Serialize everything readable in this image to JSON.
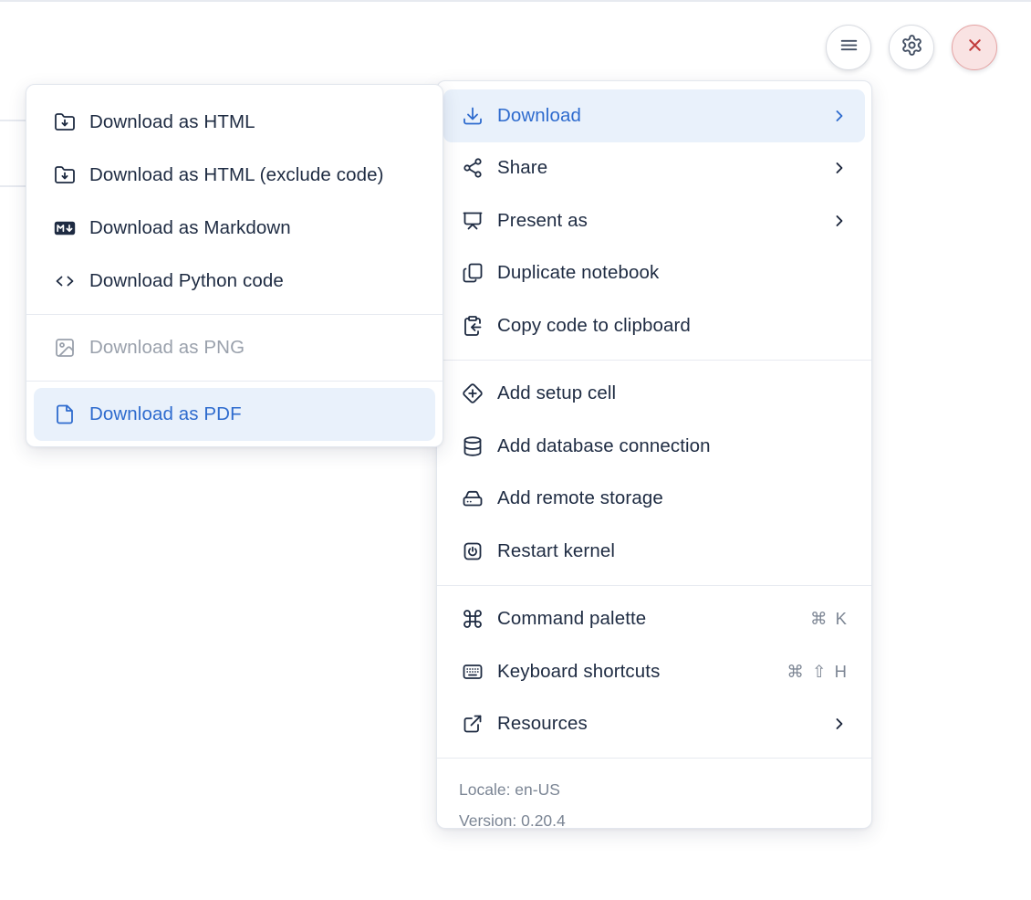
{
  "toolbar": {
    "menu_button": {
      "icon": "hamburger-icon"
    },
    "settings_button": {
      "icon": "gear-icon"
    },
    "close_button": {
      "icon": "close-icon"
    }
  },
  "download_submenu": {
    "items": [
      {
        "label": "Download as HTML",
        "icon": "folder-download-icon",
        "state": "normal"
      },
      {
        "label": "Download as HTML (exclude code)",
        "icon": "folder-download-icon",
        "state": "normal"
      },
      {
        "label": "Download as Markdown",
        "icon": "markdown-icon",
        "state": "normal"
      },
      {
        "label": "Download Python code",
        "icon": "code-icon",
        "state": "normal"
      },
      {
        "label": "Download as PNG",
        "icon": "image-icon",
        "state": "disabled"
      },
      {
        "label": "Download as PDF",
        "icon": "file-icon",
        "state": "highlighted"
      }
    ]
  },
  "main_menu": {
    "sections": [
      {
        "items": [
          {
            "label": "Download",
            "icon": "download-icon",
            "has_submenu": true,
            "state": "highlighted"
          },
          {
            "label": "Share",
            "icon": "share-icon",
            "has_submenu": true
          },
          {
            "label": "Present as",
            "icon": "presentation-icon",
            "has_submenu": true
          },
          {
            "label": "Duplicate notebook",
            "icon": "copy-icon"
          },
          {
            "label": "Copy code to clipboard",
            "icon": "clipboard-copy-icon"
          }
        ]
      },
      {
        "items": [
          {
            "label": "Add setup cell",
            "icon": "diamond-plus-icon"
          },
          {
            "label": "Add database connection",
            "icon": "database-icon"
          },
          {
            "label": "Add remote storage",
            "icon": "hard-drive-icon"
          },
          {
            "label": "Restart kernel",
            "icon": "power-square-icon"
          }
        ]
      },
      {
        "items": [
          {
            "label": "Command palette",
            "icon": "command-icon",
            "shortcut": "⌘ K"
          },
          {
            "label": "Keyboard shortcuts",
            "icon": "keyboard-icon",
            "shortcut": "⌘ ⇧ H"
          },
          {
            "label": "Resources",
            "icon": "external-link-icon",
            "has_submenu": true
          }
        ]
      }
    ],
    "footer": {
      "locale": "Locale: en-US",
      "version": "Version: 0.20.4"
    }
  },
  "colors": {
    "accent_blue": "#2e6bce",
    "highlight_bg": "#e9f1fb",
    "text": "#1e2b42",
    "muted_gray": "#7d8694",
    "disabled_gray": "#9aa1ac",
    "divider": "#e7eaf0",
    "danger_red": "#c23c3c",
    "danger_bg": "#f9e3e3"
  }
}
